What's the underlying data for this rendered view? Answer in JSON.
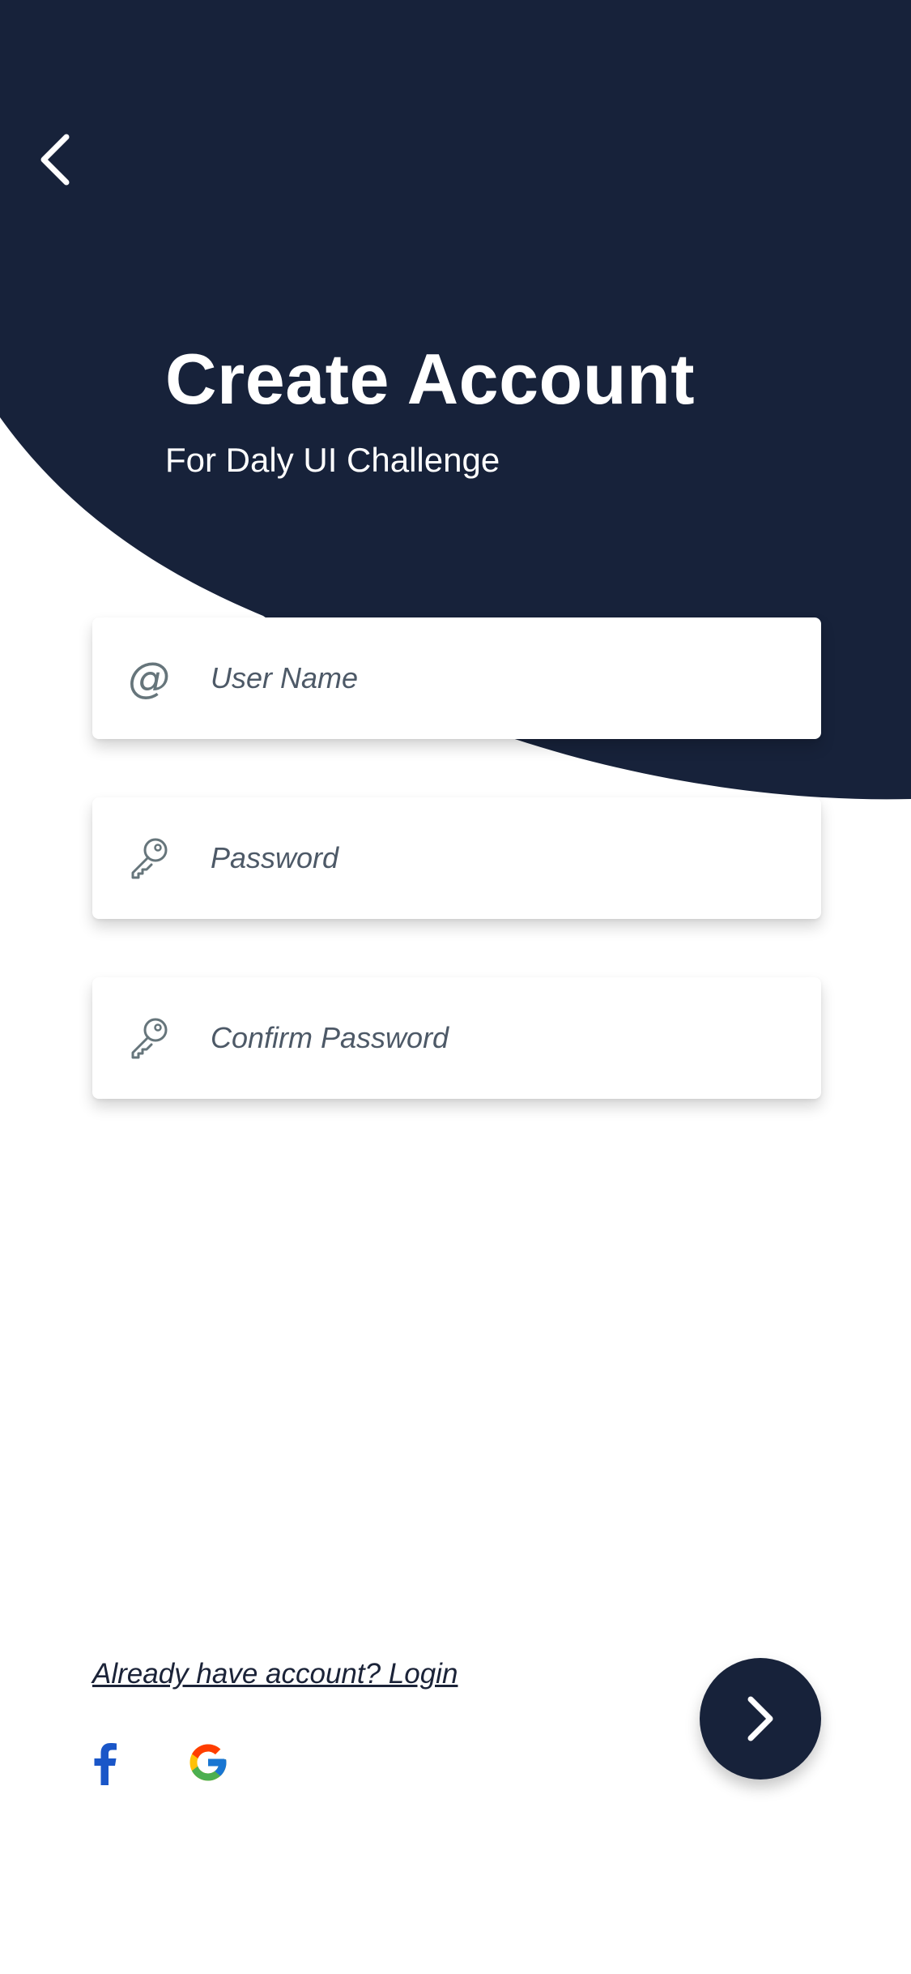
{
  "theme": {
    "primary": "#17223a",
    "background": "#ffffff",
    "facebook": "#1a56c8"
  },
  "header": {
    "back_icon": "chevron-left-icon",
    "title": "Create Account",
    "subtitle": "For Daly UI Challenge"
  },
  "form": {
    "fields": [
      {
        "icon": "at-sign-icon",
        "placeholder": "User Name",
        "type": "text"
      },
      {
        "icon": "key-icon",
        "placeholder": "Password",
        "type": "password"
      },
      {
        "icon": "key-icon",
        "placeholder": "Confirm Password",
        "type": "password"
      }
    ]
  },
  "footer": {
    "login_link": "Already have account? Login",
    "social": [
      {
        "icon": "facebook-icon"
      },
      {
        "icon": "google-icon"
      }
    ],
    "next_icon": "chevron-right-icon"
  }
}
